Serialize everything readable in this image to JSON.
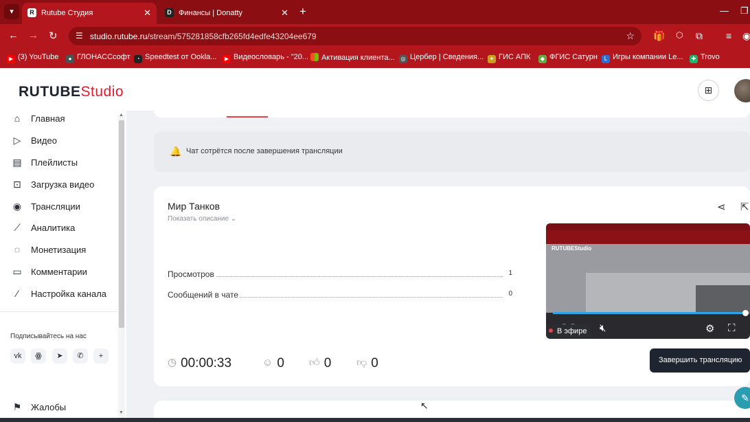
{
  "browser": {
    "tabs": [
      {
        "title": "Rutube Студия",
        "favicon": "R",
        "active": true
      },
      {
        "title": "Финансы | Donatty",
        "favicon": "D",
        "active": false
      }
    ],
    "url_host": "studio.rutube.ru",
    "url_path": "/stream/575281858cfb265fd4edfe43204ee679",
    "bookmarks": [
      "(3) YouTube",
      "ГЛОНАССсофт",
      "Speedtest от Ookla...",
      "Видеословарь - \"20...",
      "Активация клиента...",
      "Цербер | Сведения...",
      "ГИС АПК",
      "ФГИС Сатурн",
      "Игры компании Le...",
      "Trovo"
    ]
  },
  "header": {
    "logo_main": "RUTUBE",
    "logo_studio": "Studio"
  },
  "sidebar": {
    "items": [
      {
        "label": "Главная",
        "icon": "home-icon"
      },
      {
        "label": "Видео",
        "icon": "video-icon"
      },
      {
        "label": "Плейлисты",
        "icon": "playlist-icon"
      },
      {
        "label": "Загрузка видео",
        "icon": "upload-icon"
      },
      {
        "label": "Трансляции",
        "icon": "broadcast-icon"
      },
      {
        "label": "Аналитика",
        "icon": "analytics-icon"
      },
      {
        "label": "Монетизация",
        "icon": "monetization-icon"
      },
      {
        "label": "Комментарии",
        "icon": "comments-icon"
      },
      {
        "label": "Настройка канала",
        "icon": "magic-wand-icon"
      }
    ],
    "subscribe_label": "Подписывайтесь на нас",
    "socials": [
      "vk",
      "ok",
      "telegram",
      "viber",
      "more"
    ],
    "complaints_label": "Жалобы"
  },
  "notice": {
    "text": "Чат сотрётся после завершения трансляции"
  },
  "stream": {
    "title": "Мир Танков",
    "show_description": "Показать описание",
    "stats": [
      {
        "name": "Просмотров",
        "value": "1"
      },
      {
        "name": "Сообщений в чате",
        "value": "0"
      }
    ],
    "duration": "00:00:33",
    "viewers": "0",
    "likes": "0",
    "dislikes": "0",
    "live_label": "В эфире",
    "end_button": "Завершить трансляцию",
    "progress_fraction": 0.98
  },
  "colors": {
    "chrome_dark": "#8b0e13",
    "chrome": "#b3161c",
    "accent_red": "#e9424f",
    "button_dark": "#1f2530",
    "progress_blue": "#2aa6e8"
  }
}
